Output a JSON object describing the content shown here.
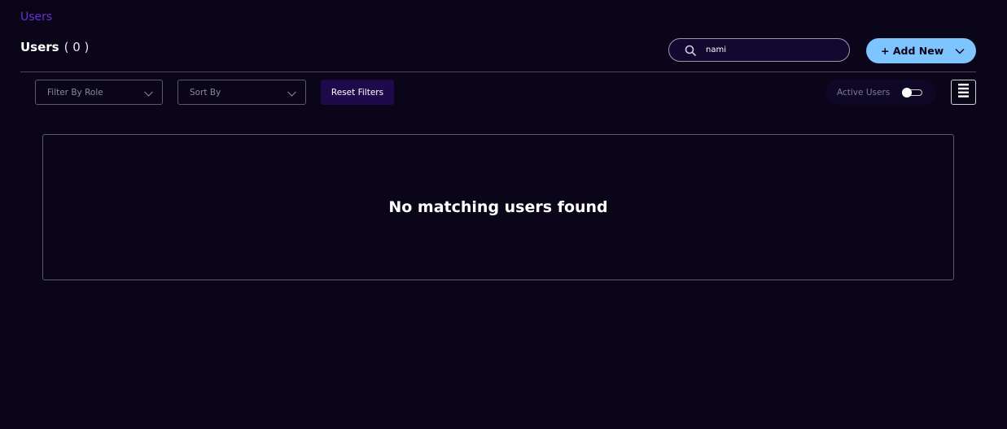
{
  "breadcrumb": {
    "label": "Users"
  },
  "header": {
    "title": "Users",
    "count": "( 0 )"
  },
  "search": {
    "value": "nami",
    "placeholder": "",
    "icon": "search-icon"
  },
  "add_new": {
    "label": "+ Add New",
    "icon": "chevron-down-icon"
  },
  "filters": {
    "role_label": "Filter By Role",
    "sort_label": "Sort By",
    "reset_label": "Reset Filters"
  },
  "active_users": {
    "label": "Active Users",
    "enabled": false
  },
  "menu": {
    "icon": "hamburger-menu-icon"
  },
  "empty_state": {
    "message": "No matching users found"
  },
  "colors": {
    "background": "#0a0519",
    "accent_link": "#6a2fd6",
    "add_button": "#7ec4ff",
    "reset_button": "#1e0a4a"
  }
}
